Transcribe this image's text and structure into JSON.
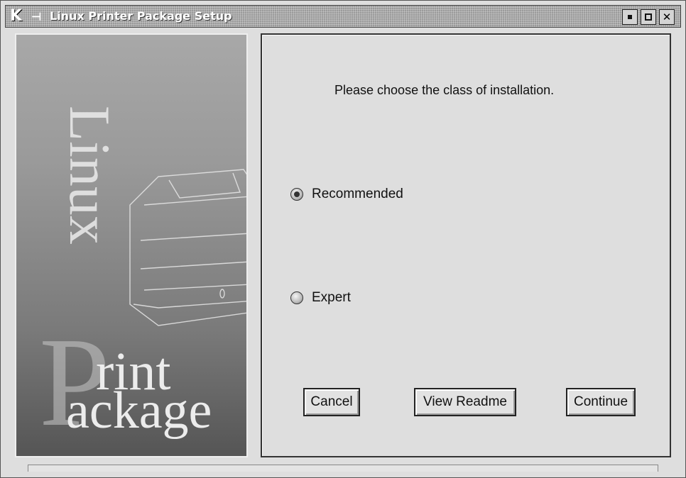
{
  "window": {
    "title": "Linux Printer Package Setup"
  },
  "titlebar": {
    "app_icon": "kde-k-icon",
    "pin_icon": "pin-icon",
    "buttons": [
      "minimize-icon",
      "maximize-icon",
      "close-icon"
    ]
  },
  "banner": {
    "word1": "Linux",
    "letter_p": "P",
    "word2": "rint",
    "word3": "ackage"
  },
  "content": {
    "prompt": "Please choose the class of installation.",
    "options": [
      {
        "label": "Recommended",
        "selected": true
      },
      {
        "label": "Expert",
        "selected": false
      }
    ],
    "buttons": {
      "cancel": "Cancel",
      "readme": "View Readme",
      "continue": "Continue"
    }
  }
}
